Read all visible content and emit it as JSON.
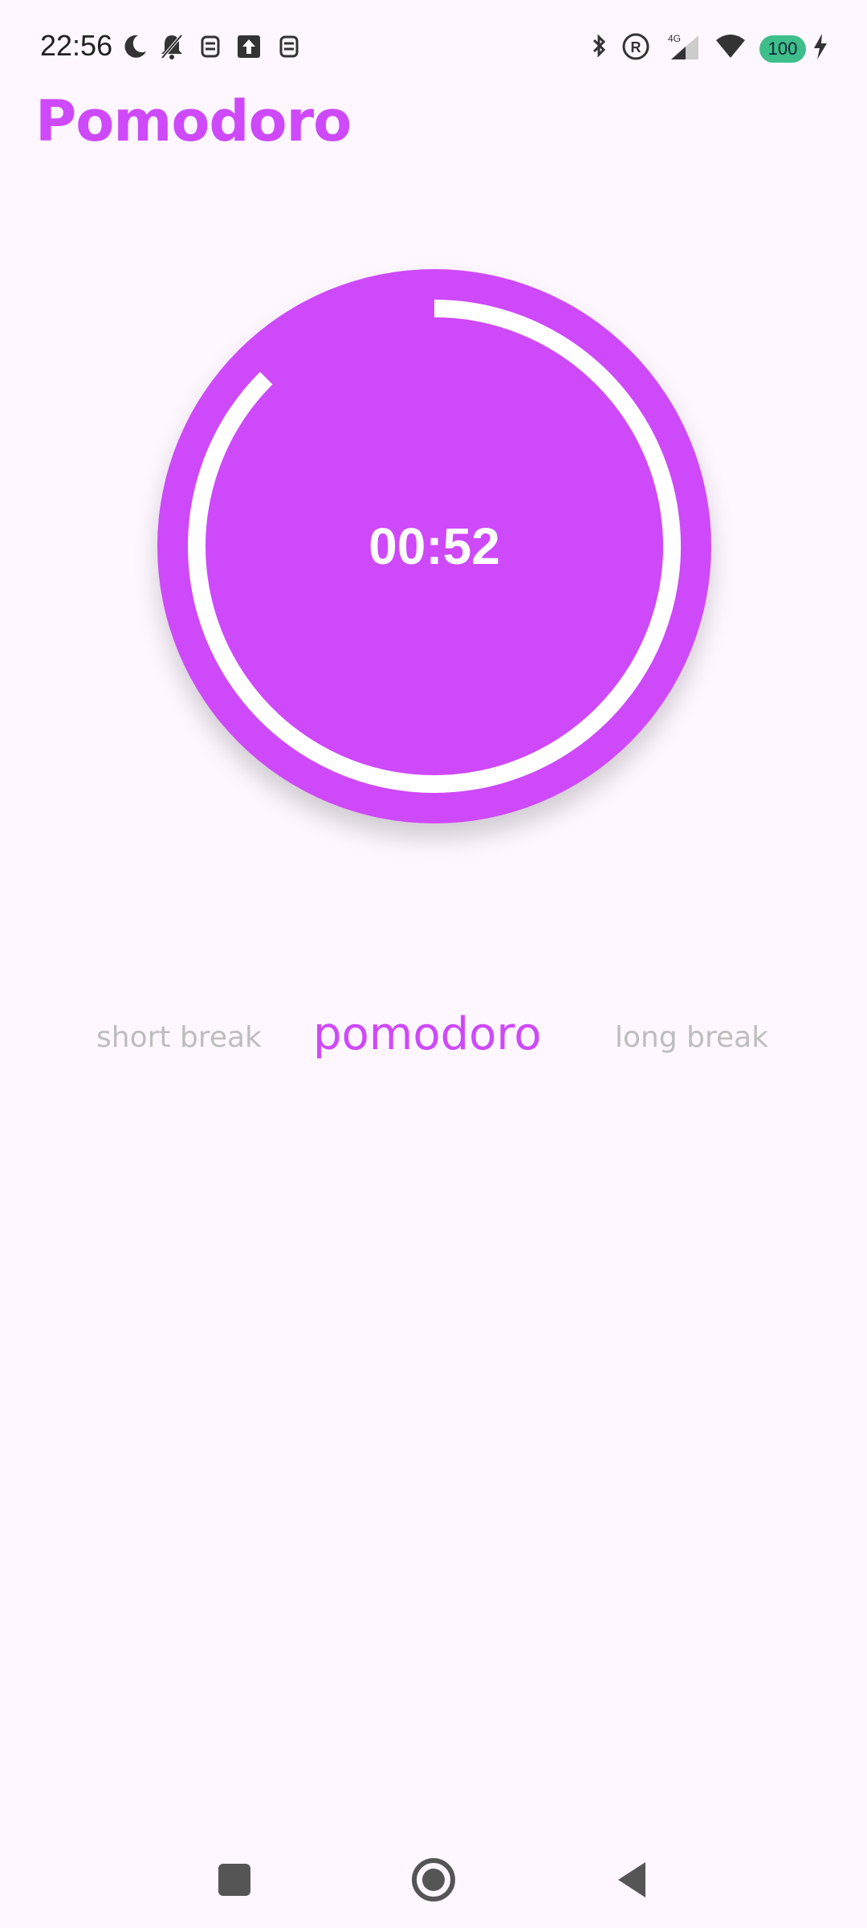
{
  "status_bar": {
    "time": "22:56",
    "battery": "100",
    "network": "4G",
    "battery_color": "#3DBE8B"
  },
  "app": {
    "title": "Pomodoro",
    "accent_color": "#CE49FA",
    "background_color": "#FEF7FF"
  },
  "timer": {
    "display": "00:52",
    "progress": 0.875
  },
  "modes": [
    {
      "label": "short break",
      "active": false
    },
    {
      "label": "pomodoro",
      "active": true
    },
    {
      "label": "long break",
      "active": false
    }
  ]
}
